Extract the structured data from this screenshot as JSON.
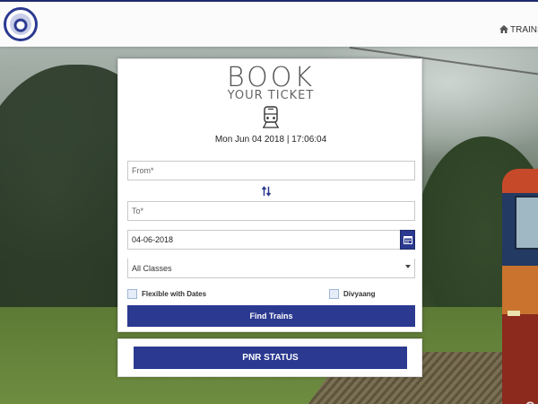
{
  "header": {
    "logo_alt": "Indian Railways",
    "nav_trains": "TRAINS"
  },
  "booking": {
    "title_main": "BOOK",
    "title_sub": "YOUR TICKET",
    "datetime": "Mon Jun 04 2018 | 17:06:04",
    "from_placeholder": "From*",
    "to_placeholder": "To*",
    "date_value": "04-06-2018",
    "class_value": "All Classes",
    "flexible_label": "Flexible with Dates",
    "divyaang_label": "Divyaang",
    "find_label": "Find Trains"
  },
  "pnr": {
    "label": "PNR STATUS"
  },
  "colors": {
    "primary": "#2b3990",
    "checkbox": "#e4edf8"
  }
}
